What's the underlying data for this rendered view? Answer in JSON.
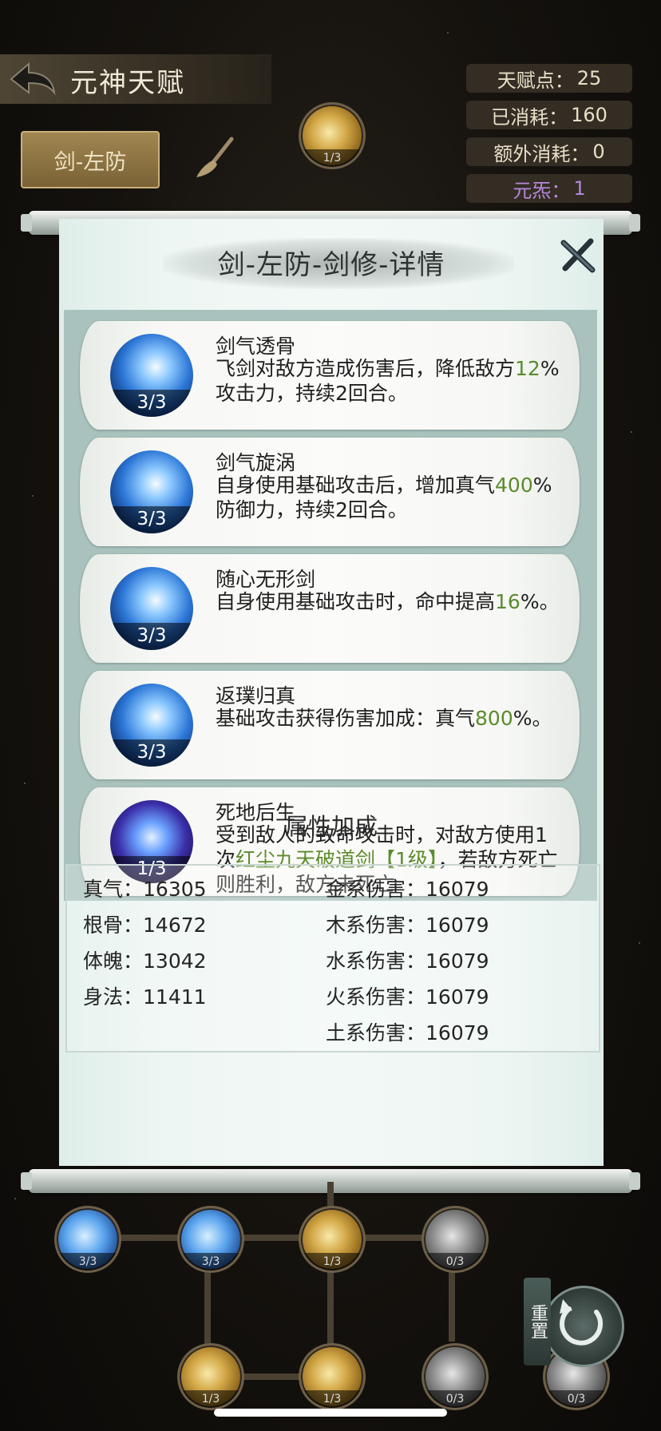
{
  "header": {
    "title": "元神天赋",
    "tab_label": "剑-左防"
  },
  "stats": [
    {
      "label": "天赋点：",
      "value": "25",
      "color": "#e8dfc8"
    },
    {
      "label": "已消耗：",
      "value": "160",
      "color": "#e8dfc8"
    },
    {
      "label": "额外消耗：",
      "value": "0",
      "color": "#e8dfc8"
    },
    {
      "label": "元炁：",
      "value": "1",
      "color": "#b689d9"
    }
  ],
  "panel": {
    "title": "剑-左防-剑修-详情",
    "skills": [
      {
        "name": "剑气透骨",
        "level": "3/3",
        "desc_parts": [
          "飞剑对敌方造成伤害后，降低敌方",
          "12",
          "%攻击力，持续2回合。"
        ]
      },
      {
        "name": "剑气旋涡",
        "level": "3/3",
        "desc_parts": [
          "自身使用基础攻击后，增加真气",
          "400",
          "%防御力，持续2回合。"
        ]
      },
      {
        "name": "随心无形剑",
        "level": "3/3",
        "desc_parts": [
          "自身使用基础攻击时，命中提高",
          "16",
          "%。"
        ]
      },
      {
        "name": "返璞归真",
        "level": "3/3",
        "desc_parts": [
          "基础攻击获得伤害加成：真气",
          "800",
          "%。"
        ]
      },
      {
        "name": "死地后生",
        "level": "1/3",
        "desc_parts": [
          "受到敌人的致命攻击时，对敌方使用1次",
          "红尘九天破道剑【1级】",
          "，若敌方死亡则胜利，敌方未死亡"
        ]
      }
    ],
    "attr_title": "属性加成",
    "attrs_left": [
      {
        "label": "真气：",
        "value": "16305"
      },
      {
        "label": "根骨：",
        "value": "14672"
      },
      {
        "label": "体魄：",
        "value": "13042"
      },
      {
        "label": "身法：",
        "value": "11411"
      }
    ],
    "attrs_right": [
      {
        "label": "金系伤害：",
        "value": "16079"
      },
      {
        "label": "木系伤害：",
        "value": "16079"
      },
      {
        "label": "水系伤害：",
        "value": "16079"
      },
      {
        "label": "火系伤害：",
        "value": "16079"
      },
      {
        "label": "土系伤害：",
        "value": "16079"
      }
    ]
  },
  "tree_nodes": {
    "top": "1/3",
    "row1": [
      "3/3",
      "3/3",
      "1/3",
      "0/3"
    ],
    "row2": [
      "1/3",
      "1/3",
      "0/3",
      "0/3"
    ]
  },
  "reset_label": "重置"
}
